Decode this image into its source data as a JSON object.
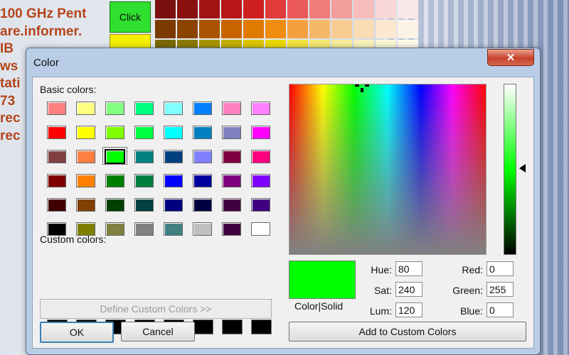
{
  "background": {
    "lines": [
      "100 GHz Pent",
      "are.informer.",
      "IB",
      "ws",
      "tati",
      "73",
      "rec",
      "rec"
    ],
    "click_button": "Click",
    "grid_colors": [
      "#7b1010",
      "#8a1010",
      "#a01313",
      "#b81616",
      "#cf2020",
      "#e03a3a",
      "#ea5a5a",
      "#f07b7b",
      "#f49d9d",
      "#f7bcbc",
      "#f9d6d6",
      "#fbe9e9",
      "#7a3a00",
      "#8a4400",
      "#a85400",
      "#c86400",
      "#e07a00",
      "#f08c10",
      "#f4a040",
      "#f6b868",
      "#f8cc90",
      "#fadcb4",
      "#fce8d0",
      "#fdf2e6",
      "#7a6a00",
      "#8a7a00",
      "#a89400",
      "#c4ae00",
      "#dcc600",
      "#ecd800",
      "#f2e240",
      "#f4e870",
      "#f6ee98",
      "#f8f2bc",
      "#faf6d6",
      "#fcf9ea",
      "#2a5a10",
      "#306818",
      "#3a7a1e",
      "#468e26",
      "#52a22e",
      "#62b63a",
      "#7ac458",
      "#94d078",
      "#aedc9a",
      "#c6e6ba",
      "#dbf0d4",
      "#edf7ea"
    ]
  },
  "dialog": {
    "title": "Color",
    "close_icon": "close-icon",
    "basic_colors_label": "Basic colors:",
    "custom_colors_label": "Custom colors:",
    "basic_colors": [
      "#ff8080",
      "#ffff80",
      "#80ff80",
      "#00ff80",
      "#80ffff",
      "#0080ff",
      "#ff80c0",
      "#ff80ff",
      "#ff0000",
      "#ffff00",
      "#80ff00",
      "#00ff40",
      "#00ffff",
      "#0080c0",
      "#8080c0",
      "#ff00ff",
      "#804040",
      "#ff8040",
      "#00ff00",
      "#008080",
      "#004080",
      "#8080ff",
      "#800040",
      "#ff0080",
      "#800000",
      "#ff8000",
      "#008000",
      "#008040",
      "#0000ff",
      "#0000a0",
      "#800080",
      "#8000ff",
      "#400000",
      "#804000",
      "#004000",
      "#004040",
      "#000080",
      "#000040",
      "#400040",
      "#400080",
      "#000000",
      "#808000",
      "#808040",
      "#808080",
      "#408080",
      "#c0c0c0",
      "#400040",
      "#ffffff"
    ],
    "selected_index": 18,
    "custom_colors": [
      "#000000",
      "#000000",
      "#000000",
      "#000000",
      "#000000",
      "#000000",
      "#000000",
      "#000000",
      "#000000",
      "#000000",
      "#000000",
      "#000000",
      "#000000",
      "#000000",
      "#000000",
      "#000000"
    ],
    "define_custom_label": "Define Custom Colors >>",
    "ok_label": "OK",
    "cancel_label": "Cancel",
    "color_solid_label": "Color|Solid",
    "add_custom_label": "Add to Custom Colors",
    "current_color": "#00ff00",
    "fields": {
      "hue_label": "Hue:",
      "hue": "80",
      "sat_label": "Sat:",
      "sat": "240",
      "lum_label": "Lum:",
      "lum": "120",
      "red_label": "Red:",
      "red": "0",
      "green_label": "Green:",
      "green": "255",
      "blue_label": "Blue:",
      "blue": "0"
    }
  }
}
